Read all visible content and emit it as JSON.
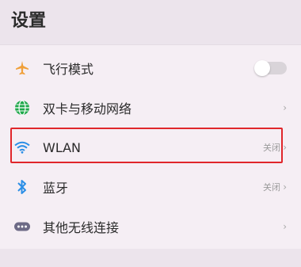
{
  "page": {
    "title": "设置"
  },
  "colors": {
    "accent_highlight": "#e0262b",
    "plane": "#f0a03a",
    "globe": "#1ea84a",
    "wifi": "#2c8fe6",
    "bluetooth": "#2c8fe6",
    "more": "#6d6a86"
  },
  "settings": {
    "items": [
      {
        "label": "飞行模式",
        "icon": "airplane-icon",
        "control": "toggle",
        "toggle_on": false
      },
      {
        "label": "双卡与移动网络",
        "icon": "globe-icon",
        "chevron": "›"
      },
      {
        "label": "WLAN",
        "icon": "wifi-icon",
        "status": "关闭",
        "chevron": "›"
      },
      {
        "label": "蓝牙",
        "icon": "bluetooth-icon",
        "status": "关闭",
        "chevron": "›"
      },
      {
        "label": "其他无线连接",
        "icon": "more-connections-icon",
        "chevron": "›"
      }
    ]
  }
}
